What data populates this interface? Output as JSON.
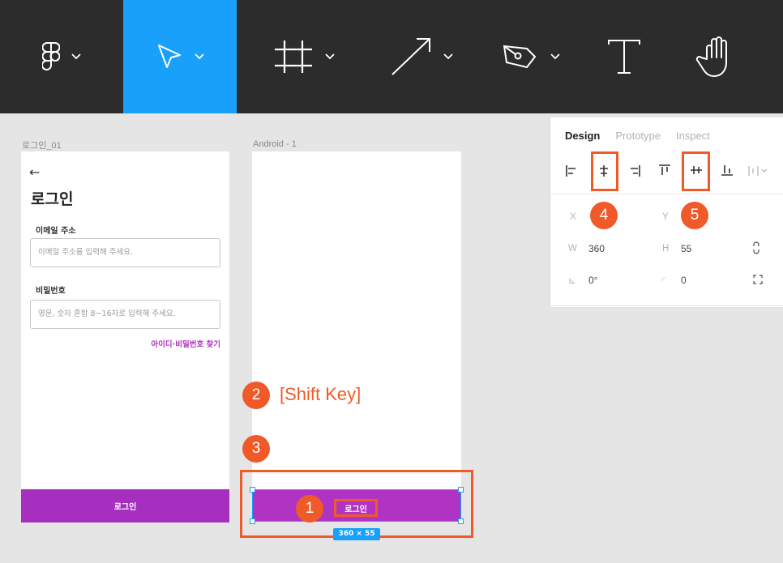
{
  "toolbar": {
    "tools": [
      {
        "name": "figma-menu-icon",
        "active": false
      },
      {
        "name": "move-tool-icon",
        "active": true
      },
      {
        "name": "frame-tool-icon",
        "active": false
      },
      {
        "name": "arrow-tool-icon",
        "active": false
      },
      {
        "name": "pen-tool-icon",
        "active": false
      },
      {
        "name": "text-tool-icon",
        "active": false
      },
      {
        "name": "hand-tool-icon",
        "active": false
      }
    ],
    "active_color": "#18a0fb",
    "bg_color": "#2c2c2c"
  },
  "canvas": {
    "frame1": {
      "label": "로그인_01",
      "back_arrow": "←",
      "title": "로그인",
      "email_label": "이메일 주소",
      "email_placeholder": "이메일 주소를 입력해 주세요.",
      "password_label": "비밀번호",
      "password_placeholder": "영문, 숫자 혼합 8~16자로 입력해 주세요.",
      "find_link": "아이디·비밀번호 찾기",
      "login_button": "로그인"
    },
    "frame2": {
      "label": "Android - 1",
      "selected_button_text": "로그인",
      "size_badge": "360 × 55"
    },
    "annotations": {
      "step1": "1",
      "step2": "2",
      "step2_text": "[Shift Key]",
      "step3": "3",
      "step4": "4",
      "step5": "5"
    },
    "accent_color": "#f05a28",
    "button_color": "#a62fc0"
  },
  "panel": {
    "tabs": [
      "Design",
      "Prototype",
      "Inspect"
    ],
    "active_tab": "Design",
    "align_icons": [
      "align-left-icon",
      "align-horizontal-center-icon",
      "align-right-icon",
      "align-top-icon",
      "align-vertical-center-icon",
      "align-bottom-icon",
      "distribute-icon"
    ],
    "x_label": "X",
    "y_label": "Y",
    "w_label": "W",
    "w_value": "360",
    "h_label": "H",
    "h_value": "55",
    "rotation_label": "⊾",
    "rotation_value": "0°",
    "radius_label": "◜",
    "radius_value": "0"
  }
}
